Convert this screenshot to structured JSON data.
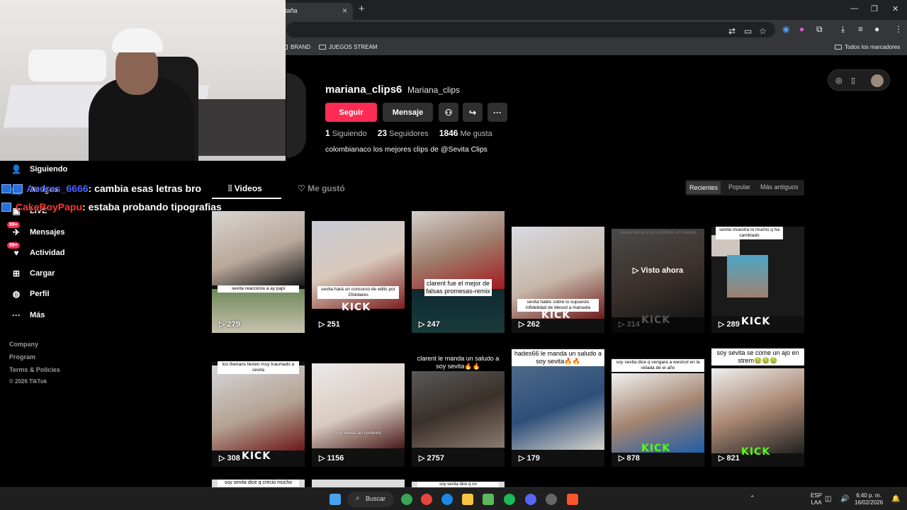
{
  "browser": {
    "tab_title": "taña",
    "tab_close": "×",
    "new_tab": "+",
    "win_min": "—",
    "win_restore": "❐",
    "win_close": "✕",
    "bookmarks": [
      "BRAND",
      "JUEGOS STREAM"
    ],
    "all_bookmarks": "Todos los marcadores"
  },
  "nav": {
    "items": [
      {
        "label": "Siguiendo",
        "icon": "following-icon"
      },
      {
        "label": "Amigos",
        "icon": "friends-icon"
      },
      {
        "label": "LIVE",
        "icon": "live-icon"
      },
      {
        "label": "Mensajes",
        "icon": "messages-icon",
        "badge": "99+"
      },
      {
        "label": "Actividad",
        "icon": "activity-icon",
        "badge": "99+"
      },
      {
        "label": "Cargar",
        "icon": "upload-icon"
      },
      {
        "label": "Perfil",
        "icon": "profile-icon"
      },
      {
        "label": "Más",
        "icon": "more-icon"
      }
    ],
    "footer": [
      "Company",
      "Program",
      "Terms & Policies",
      "© 2026 TikTok"
    ]
  },
  "chat": [
    {
      "user": "Andres_6666",
      "message": ": cambia esas letras bro",
      "color": "#4a62ff"
    },
    {
      "user": "CakeBoyPapu",
      "message": ": estaba probando tipografias",
      "color": "#ff3535"
    }
  ],
  "profile": {
    "username": "mariana_clips6",
    "nickname": "Mariana_clips",
    "follow_button": "Seguir",
    "message_button": "Mensaje",
    "following_count": "1",
    "following_label": "Siguiendo",
    "followers_count": "23",
    "followers_label": "Seguidores",
    "likes_count": "1846",
    "likes_label": "Me gusta",
    "bio": "colombianaco los mejores clips de @Sevita Clips"
  },
  "tabs": {
    "videos": "Videos",
    "liked": "Me gustó"
  },
  "sort": {
    "recent": "Recientes",
    "popular": "Popular",
    "oldest": "Más antiguos"
  },
  "videos": [
    {
      "views": "279",
      "caption": "sevita reacciona a ay papi"
    },
    {
      "views": "251",
      "caption": "sevita hará un concurso de edits por 20dolares",
      "kick": "KICK"
    },
    {
      "views": "247",
      "caption": "clarent fue el mejor de falsas promesas-remix"
    },
    {
      "views": "262",
      "caption": "sevita hablo sobre lo supuesto infidelidad de blessd a manuela",
      "kick": "KICK"
    },
    {
      "views": "314",
      "caption": "sevita llama a los sombras en stream",
      "kick": "KICK",
      "watched": "Visto ahora"
    },
    {
      "views": "289",
      "caption": "sevita muestra lo mucho q ha cambiado",
      "kick": "KICK"
    },
    {
      "views": "308",
      "caption": "los therians tienen muy traumado a sevita",
      "kick": "KICK"
    },
    {
      "views": "1156",
      "caption": "soy sevita sin contexto"
    },
    {
      "views": "2757",
      "caption": "clarent le manda un saludo a soy sevita🔥🔥"
    },
    {
      "views": "179",
      "caption": "hades66 le manda un saludo a soy sevita🔥🔥"
    },
    {
      "views": "878",
      "caption": "soy sevita dice q vengara a westcol en la velada de el año",
      "kick": "KICK"
    },
    {
      "views": "821",
      "caption": "soy sevita se come un ajo en strem🤢🤢🤢",
      "kick": "KICK"
    }
  ],
  "partial_captions": [
    "soy sevita dice q crecio mucho",
    "soy sevita dice q no"
  ],
  "taskbar": {
    "search": "Buscar",
    "lang": "ESP",
    "lang2": "LAA",
    "time": "6:40 p. m.",
    "date": "16/02/2026"
  }
}
